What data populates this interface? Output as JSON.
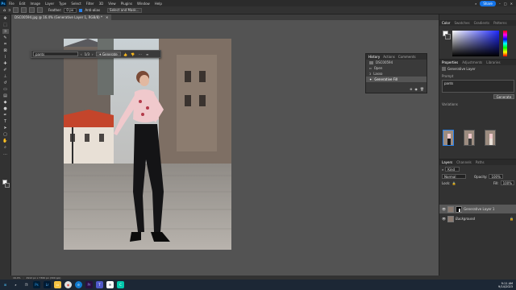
{
  "menubar": {
    "app_logo": "Ps",
    "items": [
      "File",
      "Edit",
      "Image",
      "Layer",
      "Type",
      "Select",
      "Filter",
      "3D",
      "View",
      "Plugins",
      "Window",
      "Help"
    ],
    "share_label": "Share"
  },
  "options_bar": {
    "feather_label": "Feather:",
    "feather_value": "0 px",
    "antialias_label": "Anti-alias",
    "select_mask_label": "Select and Mask..."
  },
  "document": {
    "tab_title": "DSC00594.jpg @ 16.4% (Generative Layer 1, RGB/8) *"
  },
  "contextual_taskbar": {
    "prompt_value": "pants",
    "variation_counter": "1/3",
    "generate_label": "Generate"
  },
  "history_panel": {
    "tabs": [
      "History",
      "Actions",
      "Comments"
    ],
    "rows": [
      "DSC00594",
      "Open",
      "Lasso",
      "Generative Fill"
    ]
  },
  "color_panel": {
    "tabs": [
      "Color",
      "Swatches",
      "Gradients",
      "Patterns"
    ],
    "foreground": "#ffffff",
    "background": "#3a3a3a"
  },
  "properties_panel": {
    "tabs": [
      "Properties",
      "Adjustments",
      "Libraries"
    ],
    "layer_type": "Generative Layer",
    "prompt_label": "Prompt",
    "prompt_value": "pants",
    "generate_label": "Generate",
    "variations_label": "Variations"
  },
  "layers_panel": {
    "tabs": [
      "Layers",
      "Channels",
      "Paths"
    ],
    "filter_label": "Kind",
    "blend_mode": "Normal",
    "opacity_label": "Opacity:",
    "opacity_value": "100%",
    "lock_label": "Lock:",
    "fill_label": "Fill:",
    "fill_value": "100%",
    "layers": [
      {
        "name": "Generative Layer 1",
        "selected": true
      },
      {
        "name": "Background",
        "selected": false
      }
    ]
  },
  "status_bar": {
    "zoom": "16.4%",
    "doc_size": "4912 px x 7360 px (300 ppi)"
  },
  "taskbar": {
    "icons": [
      "windows-start",
      "search",
      "task-view",
      "photoshop",
      "lightroom",
      "file-explorer",
      "chrome",
      "edge",
      "premiere",
      "teams",
      "mail",
      "cortex"
    ],
    "time": "9:11 AM",
    "date": "9/14/2023"
  }
}
